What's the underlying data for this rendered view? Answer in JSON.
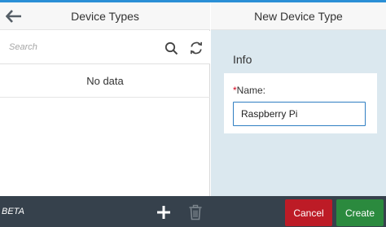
{
  "master": {
    "title": "Device Types",
    "back_icon": "arrow-left-icon",
    "search": {
      "placeholder": "Search",
      "value": "",
      "search_icon": "magnifier-icon",
      "refresh_icon": "refresh-icon"
    },
    "empty_text": "No data"
  },
  "detail": {
    "title": "New Device Type",
    "section_title": "Info",
    "form": {
      "name_label_required": "*",
      "name_label": "Name:",
      "name_value": "Raspberry Pi"
    }
  },
  "footer": {
    "beta_label": "BETA",
    "add_icon": "plus-icon",
    "delete_icon": "trash-icon",
    "cancel_label": "Cancel",
    "create_label": "Create"
  },
  "colors": {
    "accent": "#2a8fd6",
    "footer_bg": "#36414c",
    "cancel": "#bd1b26",
    "create": "#2b8a3e",
    "detail_bg": "#dbe8ef"
  }
}
